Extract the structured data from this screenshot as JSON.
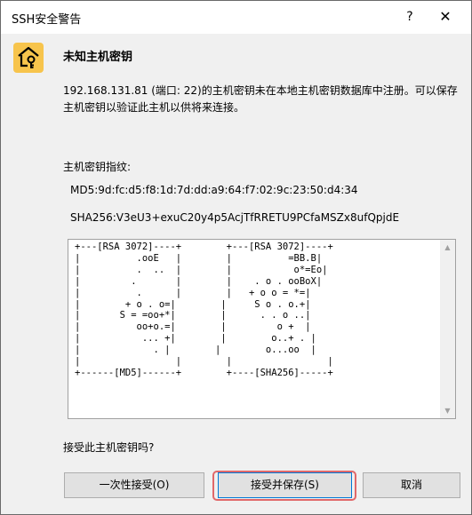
{
  "window": {
    "title": "SSH安全警告",
    "help_glyph": "?",
    "close_glyph": "✕"
  },
  "header": {
    "icon": "key-house-icon",
    "icon_color": "#f7c44c",
    "title": "未知主机密钥"
  },
  "message": "192.168.131.81 (端口: 22)的主机密钥未在本地主机密钥数据库中注册。可以保存主机密钥以验证此主机以供将来连接。",
  "fingerprint": {
    "label": "主机密钥指纹:",
    "md5": "MD5:9d:fc:d5:f8:1d:7d:dd:a9:64:f7:02:9c:23:50:d4:34",
    "sha256": "SHA256:V3eU3+exuC20y4p5AcjTfRRETU9PCfaMSZx8ufQpjdE"
  },
  "randomart": "+---[RSA 3072]----+        +---[RSA 3072]----+\n|          .ooE   |        |          =BB.B|\n|          .  ..  |        |           o*=Eo|\n|         .       |        |    . o . ooBoX|\n|          .      |        |   + o o = *=|\n|        + o . o=|        |     S o . o.+|\n|       S = =oo+*|        |      . . o ..|\n|          oo+o.=|        |         o +  |\n|           ... +|        |        o..+ . |\n|             . |        |        o...oo  |\n|                 |        |                 |\n+------[MD5]------+        +----[SHA256]-----+",
  "question": "接受此主机密钥吗?",
  "buttons": {
    "accept_once": "一次性接受(O)",
    "accept_save": "接受并保存(S)",
    "cancel": "取消"
  },
  "colors": {
    "highlight": "#e0686a",
    "default_button_border": "#0078d7"
  }
}
